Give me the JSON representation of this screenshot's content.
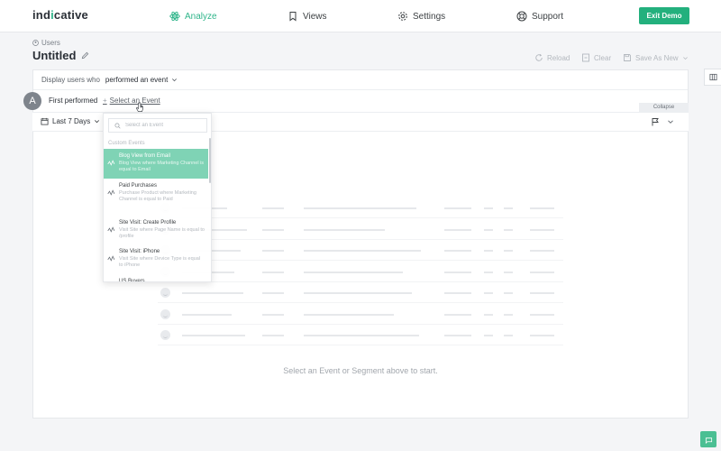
{
  "app": {
    "logo": "ind",
    "logo_dot": "i",
    "logo_rest": "cative"
  },
  "nav": {
    "analyze": "Analyze",
    "views": "Views",
    "settings": "Settings",
    "support": "Support",
    "exit_demo": "Exit Demo"
  },
  "header": {
    "breadcrumb": "Users",
    "title": "Untitled",
    "reload": "Reload",
    "clear": "Clear",
    "save_as_new": "Save As New"
  },
  "query": {
    "display_prefix": "Display users who",
    "display_mode": "performed an event",
    "step_label": "A",
    "first_performed": "First performed",
    "plus": "+",
    "select_event": "Select an Event",
    "collapse": "Collapse",
    "date_range": "Last 7 Days"
  },
  "dropdown": {
    "search_placeholder": "Select an Event",
    "section": "Custom Events",
    "items": [
      {
        "name": "Blog View from Email",
        "desc": "Blog View where Marketing Channel is equal to Email",
        "selected": true
      },
      {
        "name": "Paid Purchases",
        "desc": "Purchase Product where Marketing Channel is equal to Paid",
        "selected": false
      },
      {
        "name": "Site Visit: Create Profile",
        "desc": "Visit Site where Page Name is equal to /profile",
        "selected": false
      },
      {
        "name": "Site Visit: iPhone",
        "desc": "Visit Site where Device Type is equal to iPhone",
        "selected": false
      },
      {
        "name": "US Buyers",
        "desc": "",
        "selected": false
      }
    ]
  },
  "empty_state": {
    "message": "Select an Event or Segment above to start."
  },
  "colors": {
    "accent": "#23b07d",
    "selected_item": "#7fd3b5",
    "avatar": "#7e848c"
  }
}
